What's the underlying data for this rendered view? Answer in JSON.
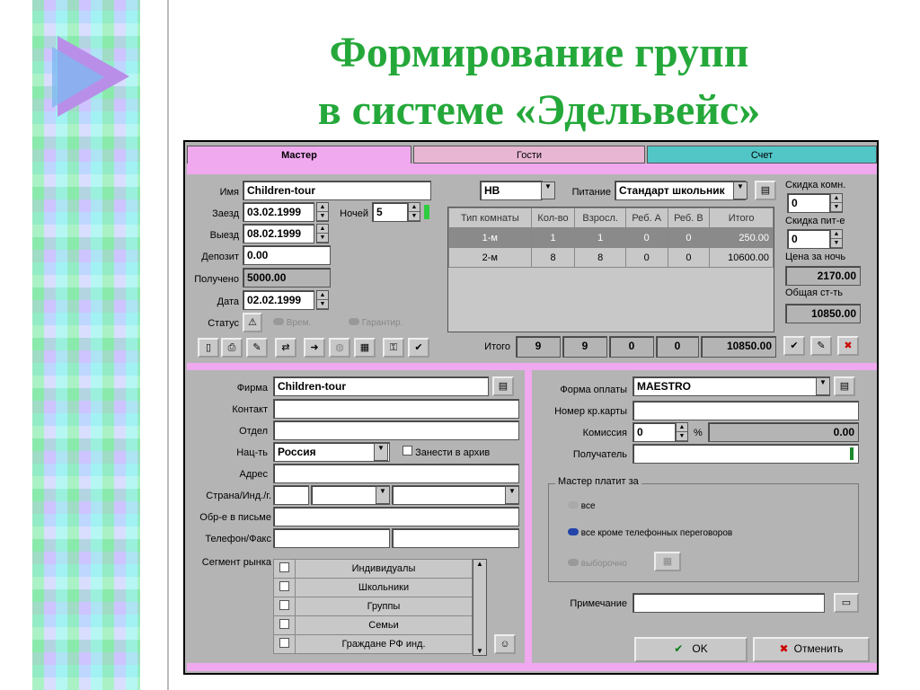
{
  "slide": {
    "title_line1": "Формирование групп",
    "title_line2": "в системе «Эдельвейс»"
  },
  "tabs": [
    "Мастер",
    "Гости",
    "Счет"
  ],
  "left": {
    "name_label": "Имя",
    "name": "Children-tour",
    "checkin_label": "Заезд",
    "checkin": "03.02.1999",
    "nights_label": "Ночей",
    "nights": "5",
    "checkout_label": "Выезд",
    "checkout": "08.02.1999",
    "deposit_label": "Депозит",
    "deposit": "0.00",
    "received_label": "Получено",
    "received": "5000.00",
    "date_label": "Дата",
    "date": "02.02.1999",
    "status_label": "Статус",
    "status_opt1": "Врем.",
    "status_opt2": "Гарантир."
  },
  "meal": {
    "plan": "HB",
    "label": "Питание",
    "value": "Стандарт школьник"
  },
  "rooms": {
    "headers": [
      "Тип комнаты",
      "Кол-во",
      "Взросл.",
      "Реб. А",
      "Реб. В",
      "Итого"
    ],
    "rows": [
      [
        "1-м",
        "1",
        "1",
        "0",
        "0",
        "250.00"
      ],
      [
        "2-м",
        "8",
        "8",
        "0",
        "0",
        "10600.00"
      ]
    ],
    "total_label": "Итого",
    "totals": [
      "9",
      "9",
      "0",
      "0",
      "10850.00"
    ]
  },
  "right": {
    "room_disc_label": "Скидка комн.",
    "room_disc": "0",
    "meal_disc_label": "Скидка пит-е",
    "meal_disc": "0",
    "night_price_label": "Цена за ночь",
    "night_price": "2170.00",
    "total_cost_label": "Общая ст-ть",
    "total_cost": "10850.00"
  },
  "firm": {
    "firm_label": "Фирма",
    "firm": "Children-tour",
    "contact_label": "Контакт",
    "dept_label": "Отдел",
    "nat_label": "Нац-ть",
    "nat": "Россия",
    "archive_label": "Занести в архив",
    "addr_label": "Адрес",
    "country_label": "Страна/Инд./г.",
    "greet_label": "Обр-е в письме",
    "phone_label": "Телефон/Факс",
    "segment_label": "Сегмент рынка",
    "segments": [
      "Индивидуалы",
      "Школьники",
      "Группы",
      "Семьи",
      "Граждане РФ инд."
    ]
  },
  "pay": {
    "form_label": "Форма оплаты",
    "form": "MAESTRO",
    "card_label": "Номер кр.карты",
    "comm_label": "Комиссия",
    "comm": "0",
    "comm_unit": "%",
    "comm_amount": "0.00",
    "payee_label": "Получатель",
    "master_pays_label": "Мастер платит за",
    "opt_all": "все",
    "opt_except": "все кроме телефонных переговоров",
    "opt_selective": "выборочно",
    "note_label": "Примечание",
    "ok": "OK",
    "cancel": "Отменить"
  }
}
